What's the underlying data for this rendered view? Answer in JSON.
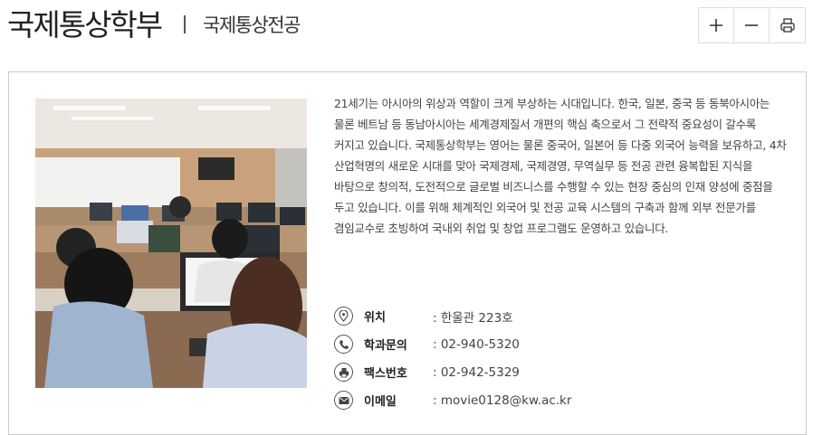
{
  "header": {
    "title": "국제통상학부",
    "subtitle": "국제통상전공"
  },
  "toolbar": {
    "zoom_in_icon": "plus-icon",
    "zoom_out_icon": "minus-icon",
    "print_icon": "printer-icon"
  },
  "intro": {
    "paragraph": "21세기는 아시아의 위상과 역할이 크게 부상하는 시대입니다. 한국, 일본, 중국 등 동북아시아는 물론 베트남 등 동남아시아는 세계경제질서 개편의 핵심 축으로서 그 전략적 중요성이 갈수록 커지고 있습니다. 국제통상학부는 영어는 물론 중국어, 일본어 등 다중 외국어 능력을 보유하고, 4차 산업혁명의 새로운 시대를 맞아 국제경제, 국제경영, 무역실무 등 전공 관련 융복합된 지식을 바탕으로 창의적, 도전적으로 글로벌 비즈니스를 수행할 수 있는 현장 중심의 인재 양성에 중점을 두고 있습니다. 이를 위해 체계적인 외국어 및 전공 교육 시스템의 구축과 함께 외부 전문가를 겸임교수로 초빙하여 국내외 취업 및 창업 프로그램도 운영하고 있습니다."
  },
  "contact": [
    {
      "label": "위치",
      "value": ": 한울관 223호",
      "icon": "location-pin-icon"
    },
    {
      "label": "학과문의",
      "value": ": 02-940-5320",
      "icon": "phone-icon"
    },
    {
      "label": "팩스번호",
      "value": ": 02-942-5329",
      "icon": "fax-icon"
    },
    {
      "label": "이메일",
      "value": ": movie0128@kw.ac.kr",
      "icon": "email-icon"
    }
  ]
}
